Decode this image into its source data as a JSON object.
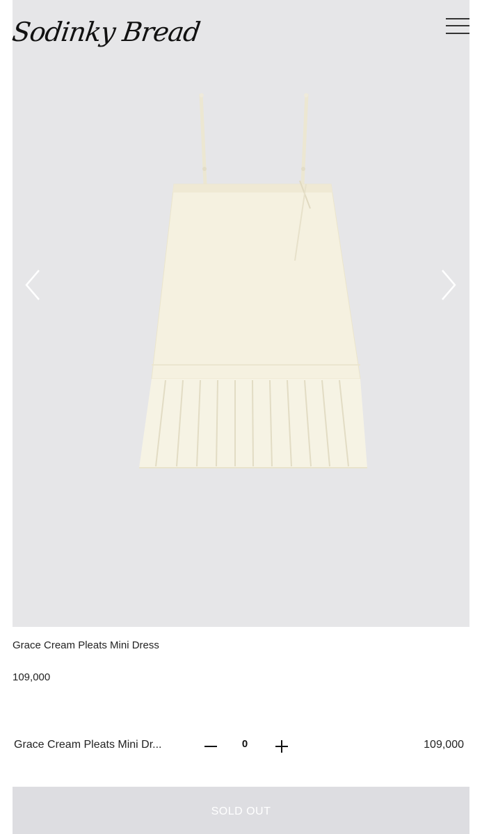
{
  "header": {
    "logo_text": "Sodinky Bread",
    "menu_icon": "hamburger-menu-icon"
  },
  "gallery": {
    "background_color": "#e6e6e8",
    "prev_icon": "chevron-left-icon",
    "next_icon": "chevron-right-icon",
    "image_subject": "cream pleated mini slip dress"
  },
  "product": {
    "name": "Grace Cream Pleats Mini Dress",
    "price": "109,000"
  },
  "option": {
    "name": "Grace Cream Pleats Mini Dr...",
    "quantity": "0",
    "price": "109,000",
    "minus_icon": "minus-icon",
    "plus_icon": "plus-icon"
  },
  "actions": {
    "soldout_label": "SOLD OUT",
    "soldout_color": "#dddde1"
  }
}
